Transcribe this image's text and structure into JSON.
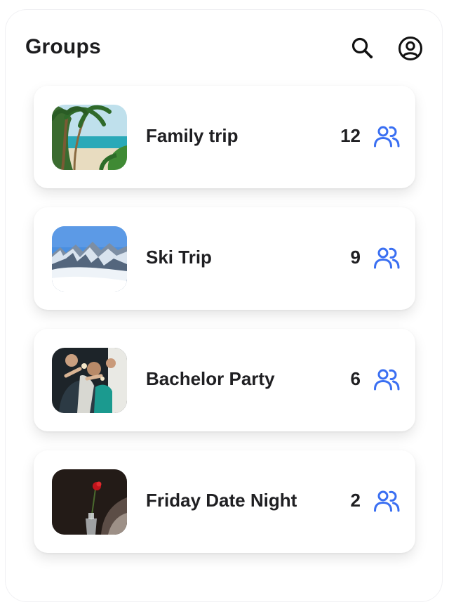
{
  "header": {
    "title": "Groups",
    "search_icon": "search-icon",
    "profile_icon": "user-circle-icon"
  },
  "groups": [
    {
      "name": "Family trip",
      "member_count": "12",
      "thumbnail": "beach-palm-trees-image",
      "members_icon": "people-icon"
    },
    {
      "name": "Ski Trip",
      "member_count": "9",
      "thumbnail": "snowy-mountains-image",
      "members_icon": "people-icon"
    },
    {
      "name": "Bachelor Party",
      "member_count": "6",
      "thumbnail": "party-people-image",
      "members_icon": "people-icon"
    },
    {
      "name": "Friday Date Night",
      "member_count": "2",
      "thumbnail": "red-rose-vase-image",
      "members_icon": "people-icon"
    }
  ],
  "colors": {
    "accent": "#3a6ff2",
    "text": "#1f1f22",
    "card_background": "#ffffff"
  }
}
